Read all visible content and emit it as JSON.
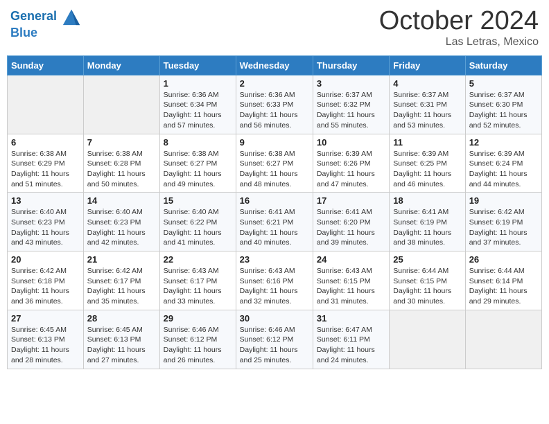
{
  "header": {
    "logo_line1": "General",
    "logo_line2": "Blue",
    "month": "October 2024",
    "location": "Las Letras, Mexico"
  },
  "weekdays": [
    "Sunday",
    "Monday",
    "Tuesday",
    "Wednesday",
    "Thursday",
    "Friday",
    "Saturday"
  ],
  "weeks": [
    [
      {
        "day": "",
        "info": ""
      },
      {
        "day": "",
        "info": ""
      },
      {
        "day": "1",
        "info": "Sunrise: 6:36 AM\nSunset: 6:34 PM\nDaylight: 11 hours and 57 minutes."
      },
      {
        "day": "2",
        "info": "Sunrise: 6:36 AM\nSunset: 6:33 PM\nDaylight: 11 hours and 56 minutes."
      },
      {
        "day": "3",
        "info": "Sunrise: 6:37 AM\nSunset: 6:32 PM\nDaylight: 11 hours and 55 minutes."
      },
      {
        "day": "4",
        "info": "Sunrise: 6:37 AM\nSunset: 6:31 PM\nDaylight: 11 hours and 53 minutes."
      },
      {
        "day": "5",
        "info": "Sunrise: 6:37 AM\nSunset: 6:30 PM\nDaylight: 11 hours and 52 minutes."
      }
    ],
    [
      {
        "day": "6",
        "info": "Sunrise: 6:38 AM\nSunset: 6:29 PM\nDaylight: 11 hours and 51 minutes."
      },
      {
        "day": "7",
        "info": "Sunrise: 6:38 AM\nSunset: 6:28 PM\nDaylight: 11 hours and 50 minutes."
      },
      {
        "day": "8",
        "info": "Sunrise: 6:38 AM\nSunset: 6:27 PM\nDaylight: 11 hours and 49 minutes."
      },
      {
        "day": "9",
        "info": "Sunrise: 6:38 AM\nSunset: 6:27 PM\nDaylight: 11 hours and 48 minutes."
      },
      {
        "day": "10",
        "info": "Sunrise: 6:39 AM\nSunset: 6:26 PM\nDaylight: 11 hours and 47 minutes."
      },
      {
        "day": "11",
        "info": "Sunrise: 6:39 AM\nSunset: 6:25 PM\nDaylight: 11 hours and 46 minutes."
      },
      {
        "day": "12",
        "info": "Sunrise: 6:39 AM\nSunset: 6:24 PM\nDaylight: 11 hours and 44 minutes."
      }
    ],
    [
      {
        "day": "13",
        "info": "Sunrise: 6:40 AM\nSunset: 6:23 PM\nDaylight: 11 hours and 43 minutes."
      },
      {
        "day": "14",
        "info": "Sunrise: 6:40 AM\nSunset: 6:23 PM\nDaylight: 11 hours and 42 minutes."
      },
      {
        "day": "15",
        "info": "Sunrise: 6:40 AM\nSunset: 6:22 PM\nDaylight: 11 hours and 41 minutes."
      },
      {
        "day": "16",
        "info": "Sunrise: 6:41 AM\nSunset: 6:21 PM\nDaylight: 11 hours and 40 minutes."
      },
      {
        "day": "17",
        "info": "Sunrise: 6:41 AM\nSunset: 6:20 PM\nDaylight: 11 hours and 39 minutes."
      },
      {
        "day": "18",
        "info": "Sunrise: 6:41 AM\nSunset: 6:19 PM\nDaylight: 11 hours and 38 minutes."
      },
      {
        "day": "19",
        "info": "Sunrise: 6:42 AM\nSunset: 6:19 PM\nDaylight: 11 hours and 37 minutes."
      }
    ],
    [
      {
        "day": "20",
        "info": "Sunrise: 6:42 AM\nSunset: 6:18 PM\nDaylight: 11 hours and 36 minutes."
      },
      {
        "day": "21",
        "info": "Sunrise: 6:42 AM\nSunset: 6:17 PM\nDaylight: 11 hours and 35 minutes."
      },
      {
        "day": "22",
        "info": "Sunrise: 6:43 AM\nSunset: 6:17 PM\nDaylight: 11 hours and 33 minutes."
      },
      {
        "day": "23",
        "info": "Sunrise: 6:43 AM\nSunset: 6:16 PM\nDaylight: 11 hours and 32 minutes."
      },
      {
        "day": "24",
        "info": "Sunrise: 6:43 AM\nSunset: 6:15 PM\nDaylight: 11 hours and 31 minutes."
      },
      {
        "day": "25",
        "info": "Sunrise: 6:44 AM\nSunset: 6:15 PM\nDaylight: 11 hours and 30 minutes."
      },
      {
        "day": "26",
        "info": "Sunrise: 6:44 AM\nSunset: 6:14 PM\nDaylight: 11 hours and 29 minutes."
      }
    ],
    [
      {
        "day": "27",
        "info": "Sunrise: 6:45 AM\nSunset: 6:13 PM\nDaylight: 11 hours and 28 minutes."
      },
      {
        "day": "28",
        "info": "Sunrise: 6:45 AM\nSunset: 6:13 PM\nDaylight: 11 hours and 27 minutes."
      },
      {
        "day": "29",
        "info": "Sunrise: 6:46 AM\nSunset: 6:12 PM\nDaylight: 11 hours and 26 minutes."
      },
      {
        "day": "30",
        "info": "Sunrise: 6:46 AM\nSunset: 6:12 PM\nDaylight: 11 hours and 25 minutes."
      },
      {
        "day": "31",
        "info": "Sunrise: 6:47 AM\nSunset: 6:11 PM\nDaylight: 11 hours and 24 minutes."
      },
      {
        "day": "",
        "info": ""
      },
      {
        "day": "",
        "info": ""
      }
    ]
  ]
}
